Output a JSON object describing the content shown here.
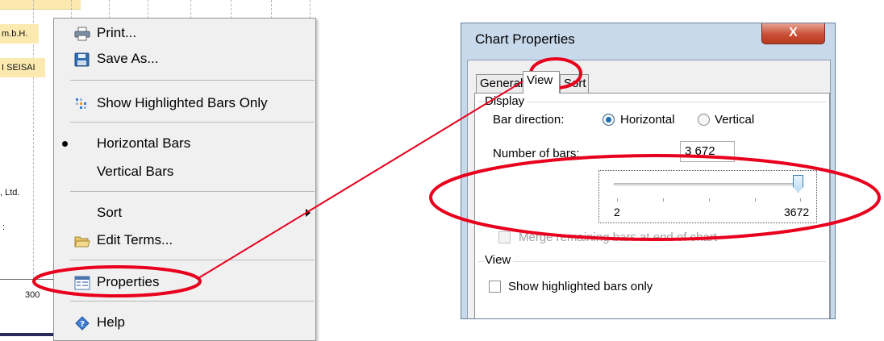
{
  "chart_fragment": {
    "bar_labels": [
      "m.b.H.",
      "I SEISAI"
    ],
    "other_labels": [
      ", Ltd.",
      ":"
    ],
    "axis_tick": "300"
  },
  "context_menu": {
    "items": {
      "print": {
        "label": "Print...",
        "icon": "printer-icon"
      },
      "save_as": {
        "label": "Save As...",
        "icon": "floppy-disk-icon"
      },
      "show_highlighted": {
        "label": "Show Highlighted Bars Only",
        "icon": "highlight-bars-icon"
      },
      "horizontal_bars": {
        "label": "Horizontal Bars",
        "selected": true
      },
      "vertical_bars": {
        "label": "Vertical Bars"
      },
      "sort": {
        "label": "Sort",
        "has_submenu": true
      },
      "edit_terms": {
        "label": "Edit Terms...",
        "icon": "folder-open-icon"
      },
      "properties": {
        "label": "Properties",
        "icon": "properties-icon"
      },
      "help": {
        "label": "Help",
        "icon": "help-icon"
      }
    }
  },
  "dialog": {
    "title": "Chart Properties",
    "close_label": "X",
    "tabs": [
      "General",
      "View",
      "Sort"
    ],
    "active_tab": "View",
    "display_group": {
      "title": "Display",
      "bar_direction_label": "Bar direction:",
      "options": [
        "Horizontal",
        "Vertical"
      ],
      "selected_option": "Horizontal",
      "number_of_bars_label": "Number of bars:",
      "number_of_bars_value": "3 672",
      "slider_min_label": "2",
      "slider_max_label": "3672",
      "slider_fraction": 1.0
    },
    "merge_label": "Merge remaining bars at end of chart",
    "view_group": {
      "title": "View",
      "show_highlighted_label": "Show highlighted bars only"
    }
  },
  "annotation_color": "#e8001c"
}
